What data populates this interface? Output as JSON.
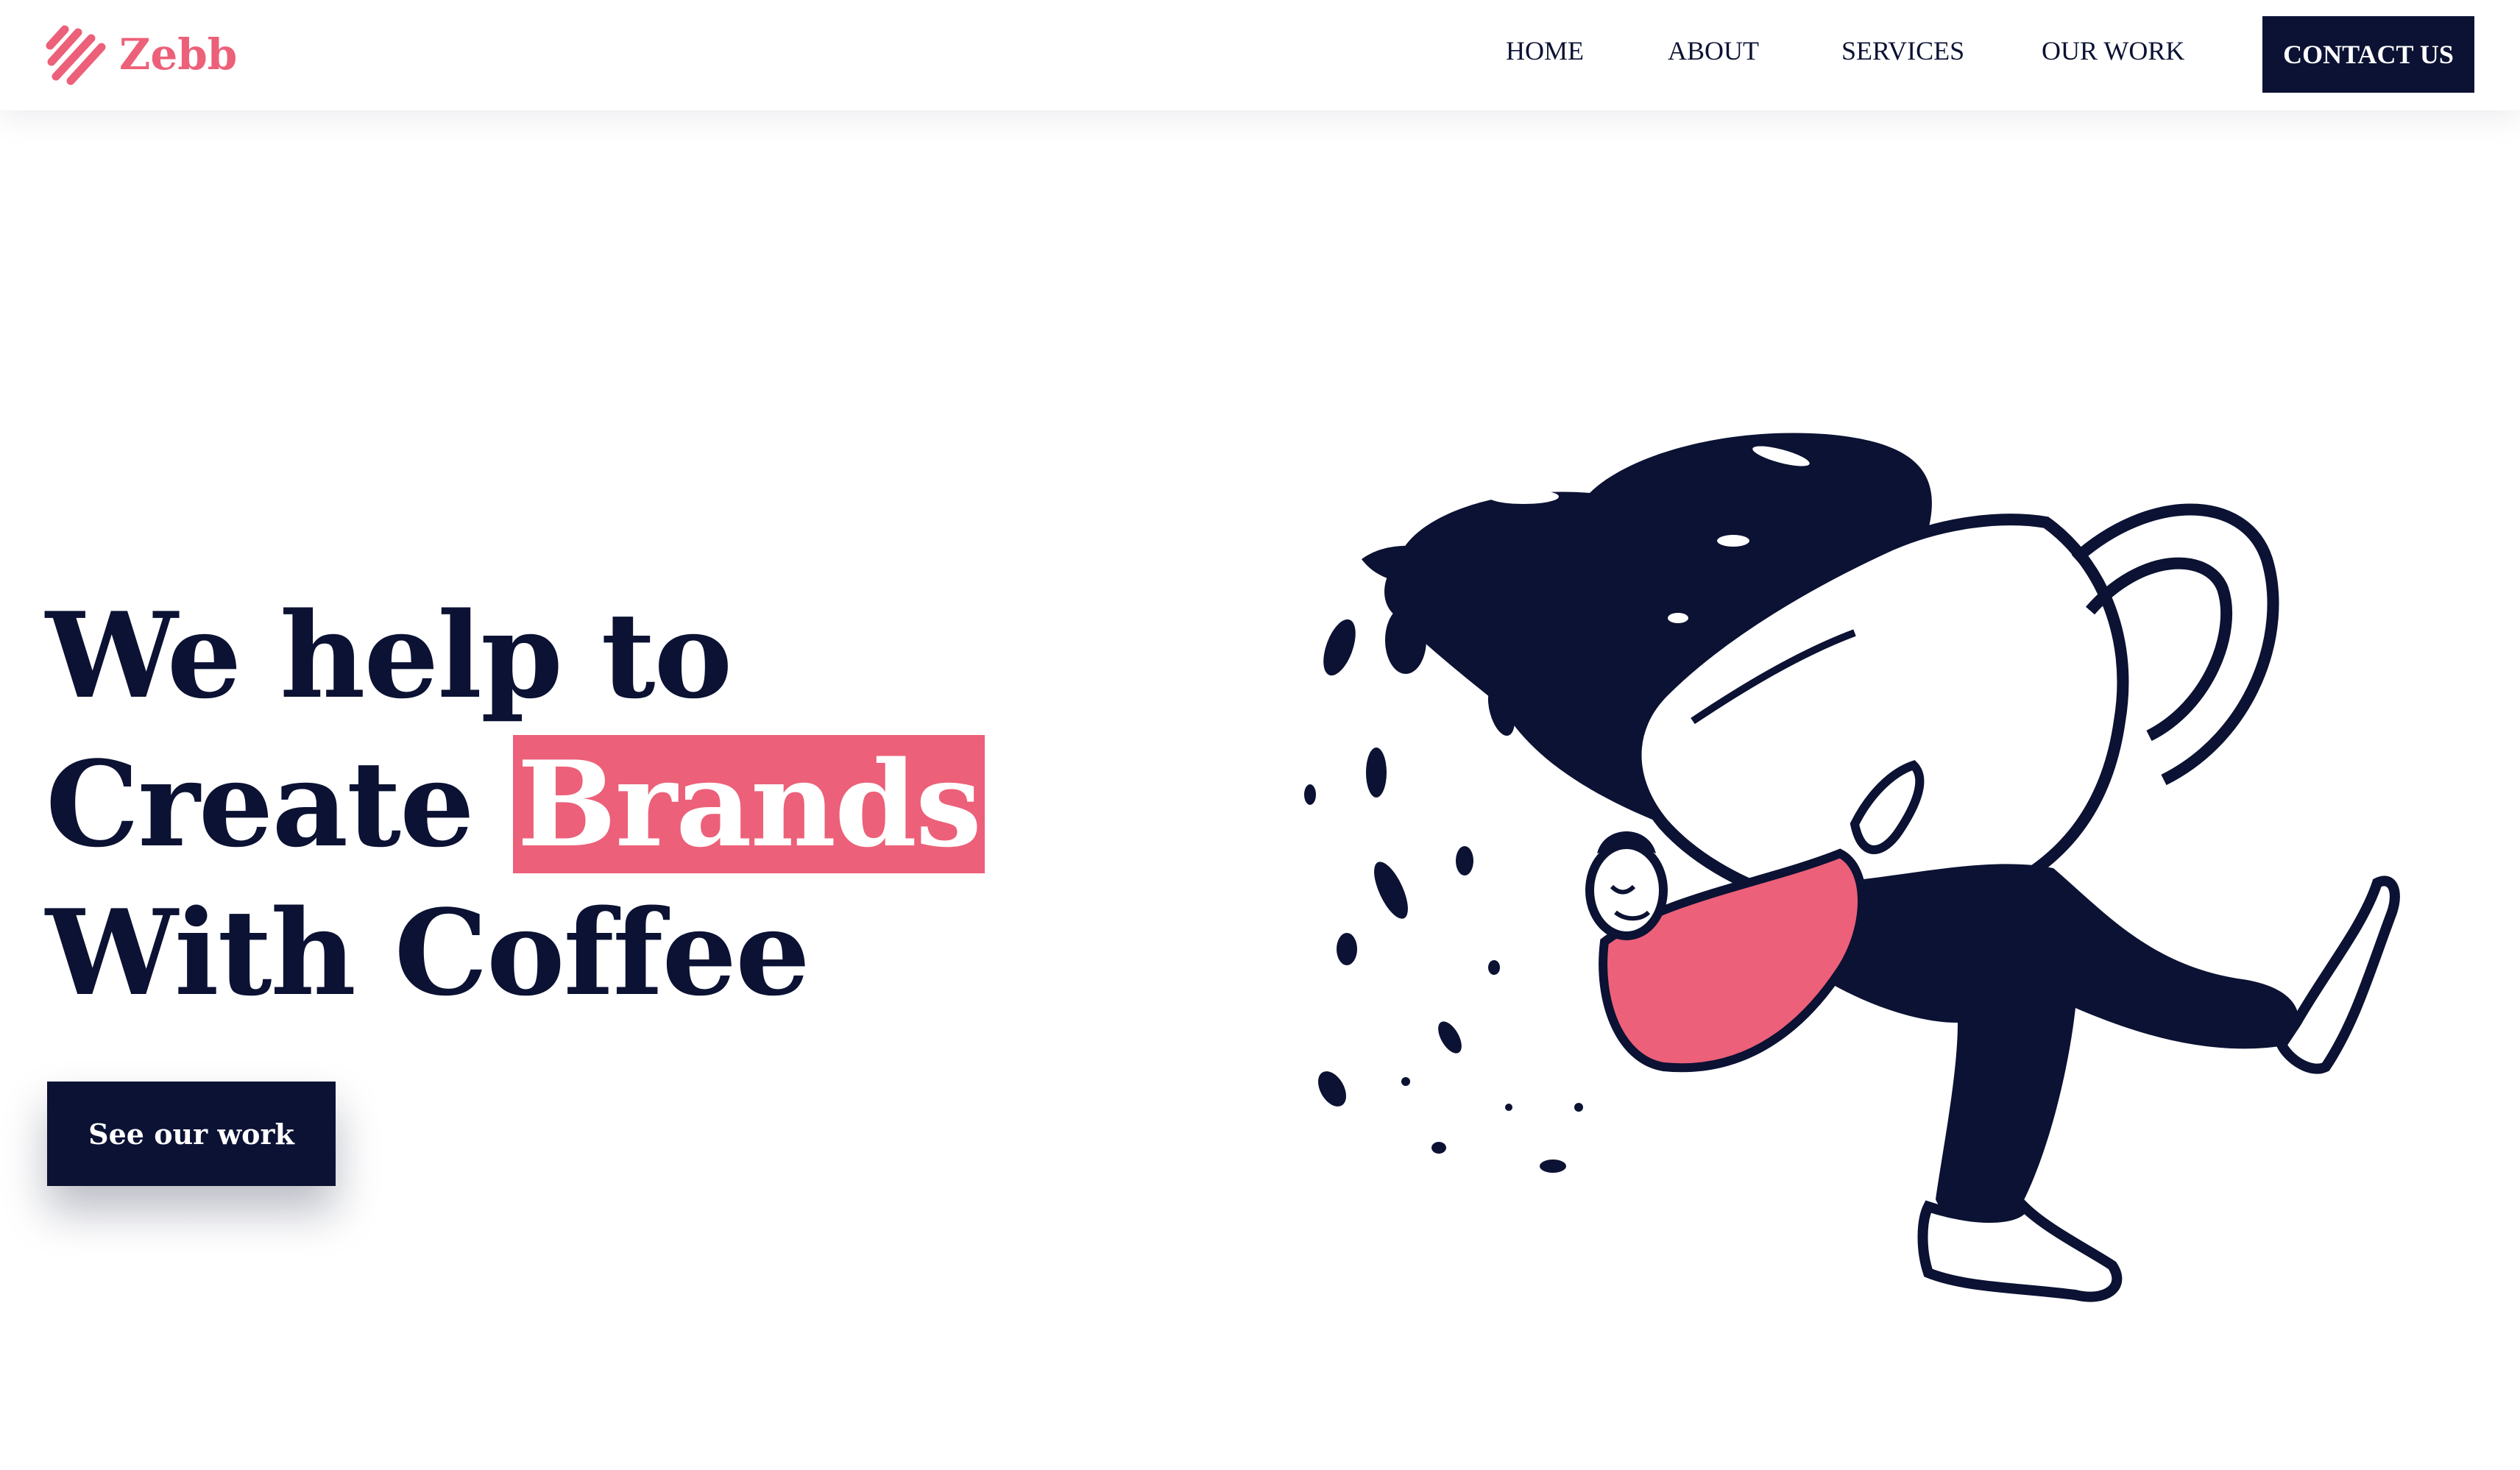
{
  "brand": {
    "name": "Zebb",
    "logo_icon": "diagonal-stripes-icon",
    "color": "#ec6079"
  },
  "nav": {
    "items": [
      {
        "label": "HOME"
      },
      {
        "label": "ABOUT"
      },
      {
        "label": "SERVICES"
      },
      {
        "label": "OUR WORK"
      }
    ],
    "contact_label": "CONTACT US"
  },
  "hero": {
    "line1": "We help to",
    "line2_prefix": "Create ",
    "line2_highlight": "Brands",
    "line3": "With Coffee",
    "cta_label": "See our work",
    "illustration": "person-carrying-spilling-coffee-cup-illustration"
  },
  "colors": {
    "navy": "#0b1233",
    "pink": "#ec6079",
    "background": "#ffffff"
  }
}
